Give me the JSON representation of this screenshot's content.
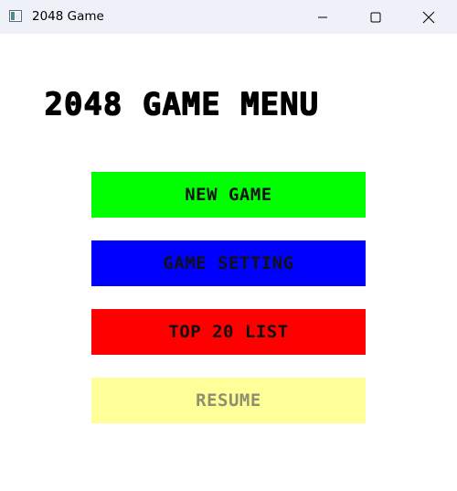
{
  "window": {
    "title": "2048 Game"
  },
  "menu": {
    "title": "2048 GAME MENU",
    "buttons": [
      {
        "label": "NEW GAME",
        "background": "#00ff00",
        "text_color": "#111111",
        "enabled": true
      },
      {
        "label": "GAME SETTING",
        "background": "#0000ff",
        "text_color": "#111111",
        "enabled": true
      },
      {
        "label": "TOP 20 LIST",
        "background": "#ff0000",
        "text_color": "#111111",
        "enabled": true
      },
      {
        "label": "RESUME",
        "background": "#ffff99",
        "text_color": "#8f8f6e",
        "enabled": false
      }
    ]
  },
  "icons": {
    "app": "app-window-icon",
    "minimize": "minimize-icon",
    "maximize": "maximize-icon",
    "close": "close-icon"
  }
}
